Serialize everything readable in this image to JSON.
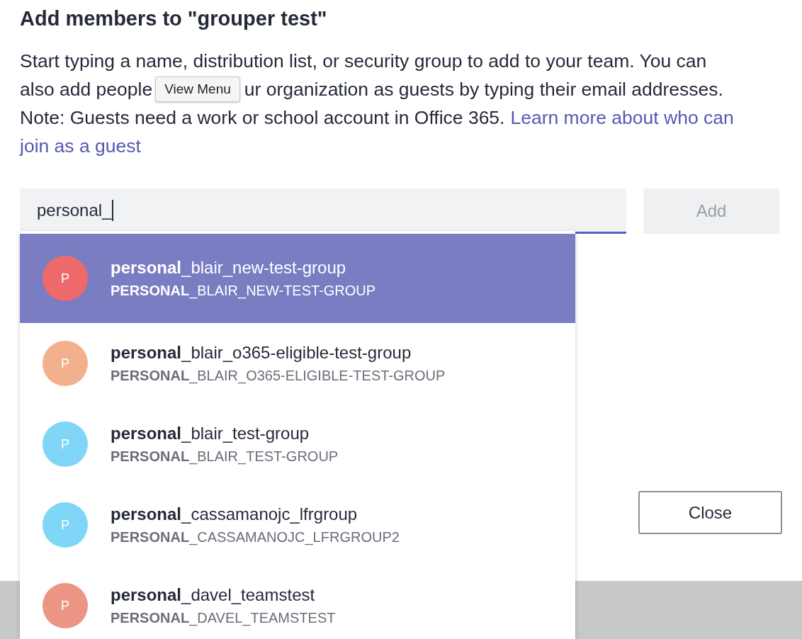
{
  "dialog": {
    "title": "Add members to \"grouper test\"",
    "line_1": "Start typing a name, distribution list, or security group to add to your team. You can",
    "line_2_before": "also add people",
    "tooltip": "View Menu",
    "line_2_after": "ur organization as guests by typing their email addresses.",
    "line_3": "Note: Guests need a work or school account in Office 365.",
    "link_lines": [
      "Learn more about who can",
      "join as a guest"
    ],
    "search": {
      "value": "personal_"
    },
    "add_button": {
      "label": "Add",
      "disabled": true
    },
    "close_button": "Close",
    "suggestions": [
      {
        "avatar": "P",
        "color": "#ee6a6a",
        "name": "**personal**_blair_new-test-group",
        "subtitle": "**PERSONAL**_BLAIR_NEW-TEST-GROUP",
        "selected": true
      },
      {
        "avatar": "P",
        "color": "#f2b18c",
        "name": "**personal**_blair_o365-eligible-test-group",
        "subtitle": "**PERSONAL**_BLAIR_O365-ELIGIBLE-TEST-GROUP",
        "selected": false
      },
      {
        "avatar": "P",
        "color": "#7fd6f7",
        "name": "**personal**_blair_test-group",
        "subtitle": "**PERSONAL**_BLAIR_TEST-GROUP",
        "selected": false
      },
      {
        "avatar": "P",
        "color": "#7fd6f7",
        "name": "**personal**_cassamanojc_lfrgroup",
        "subtitle": "**PERSONAL**_CASSAMANOJC_LFRGROUP2",
        "selected": false
      },
      {
        "avatar": "P",
        "color": "#ec9585",
        "name": "**personal**_davel_teamstest",
        "subtitle": "**PERSONAL**_DAVEL_TEAMSTEST",
        "selected": false
      }
    ]
  }
}
